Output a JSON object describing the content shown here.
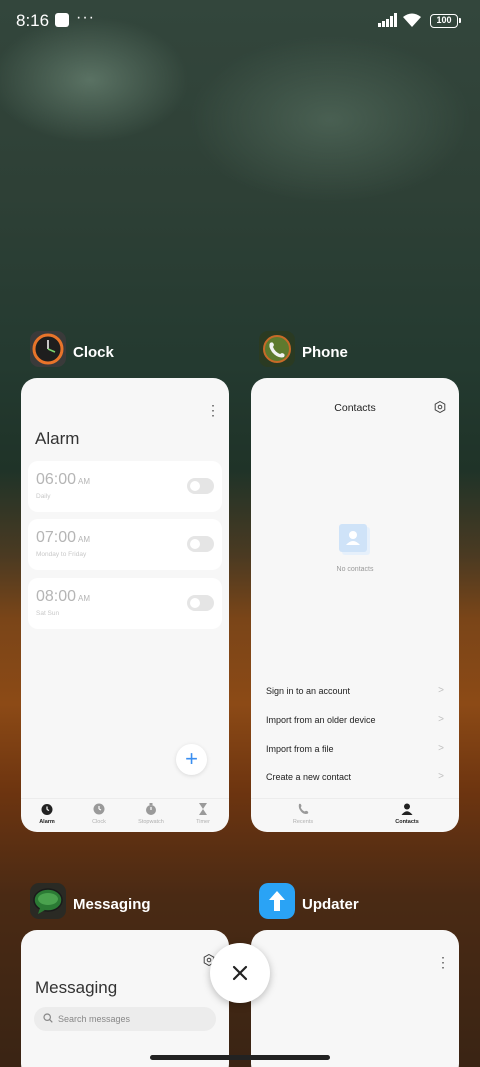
{
  "status_bar": {
    "time": "8:16",
    "dots": "···",
    "battery": "100"
  },
  "apps": {
    "clock": {
      "name": "Clock",
      "title": "Alarm",
      "menu": "⋮",
      "alarms": [
        {
          "time": "06:00",
          "ampm": "AM",
          "repeat": "Daily",
          "enabled": false
        },
        {
          "time": "07:00",
          "ampm": "AM",
          "repeat": "Monday to Friday",
          "enabled": false
        },
        {
          "time": "08:00",
          "ampm": "AM",
          "repeat": "Sat Sun",
          "enabled": false
        }
      ],
      "add_label": "+",
      "tabs": [
        "Alarm",
        "Clock",
        "Stopwatch",
        "Timer"
      ]
    },
    "phone": {
      "name": "Phone",
      "title": "Contacts",
      "empty_text": "No contacts",
      "options": [
        "Sign in to an account",
        "Import from an older device",
        "Import from a file",
        "Create a new contact"
      ],
      "tabs": [
        "Recents",
        "Contacts"
      ]
    },
    "messaging": {
      "name": "Messaging",
      "title": "Messaging",
      "search_placeholder": "Search messages"
    },
    "updater": {
      "name": "Updater",
      "menu": "⋮"
    }
  },
  "close_label": "×"
}
